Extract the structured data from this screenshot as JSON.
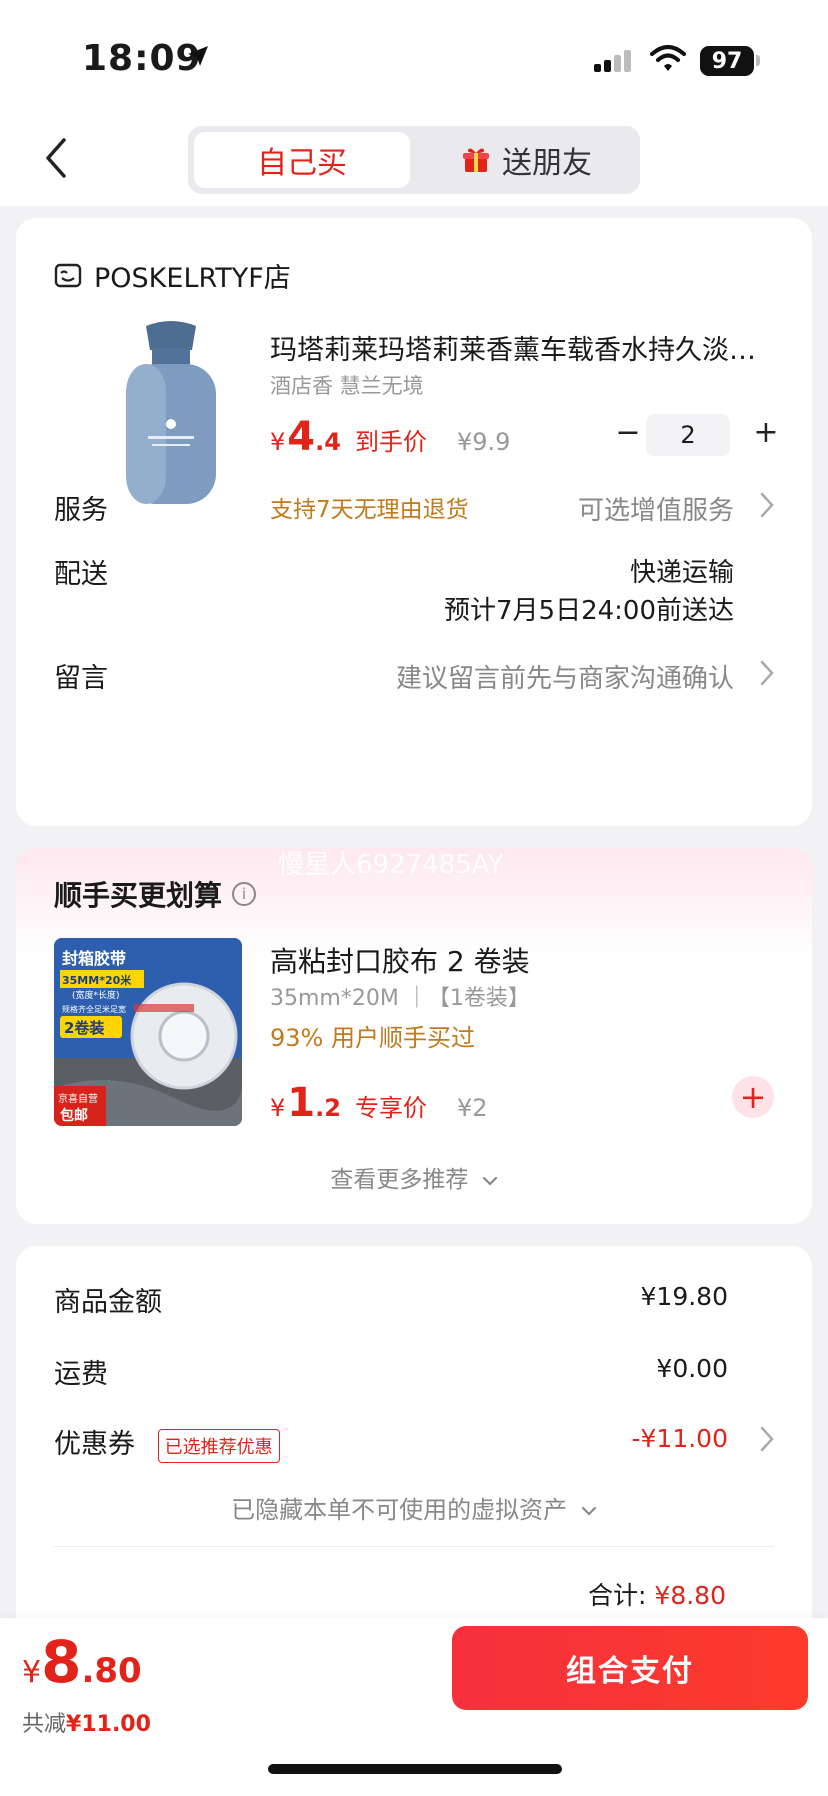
{
  "status_bar": {
    "time": "18:09",
    "battery": "97"
  },
  "nav": {
    "tab_self": "自己买",
    "tab_gift": "送朋友"
  },
  "shop": {
    "name": "POSKELRTYF店"
  },
  "product": {
    "title": "玛塔莉莱玛塔莉莱香薰车载香水持久淡…",
    "spec": "酒店香 慧兰无境",
    "currency": "¥",
    "price_int": "4",
    "price_dec": ".4",
    "price_tag": "到手价",
    "orig_price": "¥9.9",
    "qty_minus": "−",
    "quantity": "2",
    "qty_plus": "+",
    "return_policy": "支持7天无理由退货"
  },
  "service": {
    "label": "服务",
    "value": "可选增值服务"
  },
  "delivery": {
    "label": "配送",
    "method": "快递运输",
    "eta": "预计7月5日24:00前送达"
  },
  "note": {
    "label": "留言",
    "placeholder": "建议留言前先与商家沟通确认"
  },
  "recommend": {
    "watermark": "慢星人6927485AY",
    "title": "顺手买更划算",
    "info_glyph": "i",
    "item_name": "高粘封口胶布 2 卷装",
    "item_spec": "35mm*20M ｜【1卷装】",
    "bought_text": "93% 用户顺手买过",
    "currency": "¥",
    "price_int": "1",
    "price_dec": ".2",
    "price_tag": "专享价",
    "orig_price": "¥2",
    "add_glyph": "+",
    "image_labels": {
      "tape": "封箱胶带",
      "size": "35MM*20米",
      "size_sub": "(宽度*长度)",
      "tagline": "规格齐全足米足宽",
      "pack": "2卷装",
      "jd": "京喜自营",
      "free_ship": "包邮"
    },
    "more_text": "查看更多推荐"
  },
  "summary": {
    "goods_label": "商品金额",
    "goods_value": "¥19.80",
    "shipping_label": "运费",
    "shipping_value": "¥0.00",
    "coupon_label": "优惠券",
    "coupon_badge": "已选推荐优惠",
    "coupon_value": "-¥11.00",
    "hidden_assets": "已隐藏本单不可使用的虚拟资产",
    "total_label": "合计:",
    "total_value": "¥8.80"
  },
  "bottom_bar": {
    "currency": "¥",
    "price_int": "8",
    "price_dec": ".80",
    "save_label": "共减",
    "save_value": "¥11.00",
    "pay_button": "组合支付"
  },
  "colors": {
    "accent": "#e2231a",
    "gold": "#c27a1c",
    "pay_gradient_start": "#f5303d",
    "pay_gradient_end": "#fe3b2b"
  },
  "icons": [
    "location-arrow-icon",
    "signal-icon",
    "wifi-icon",
    "battery-icon",
    "back-chevron-icon",
    "gift-icon",
    "shop-icon",
    "chevron-right-icon",
    "info-icon",
    "plus-circle-icon",
    "chevron-down-icon"
  ]
}
